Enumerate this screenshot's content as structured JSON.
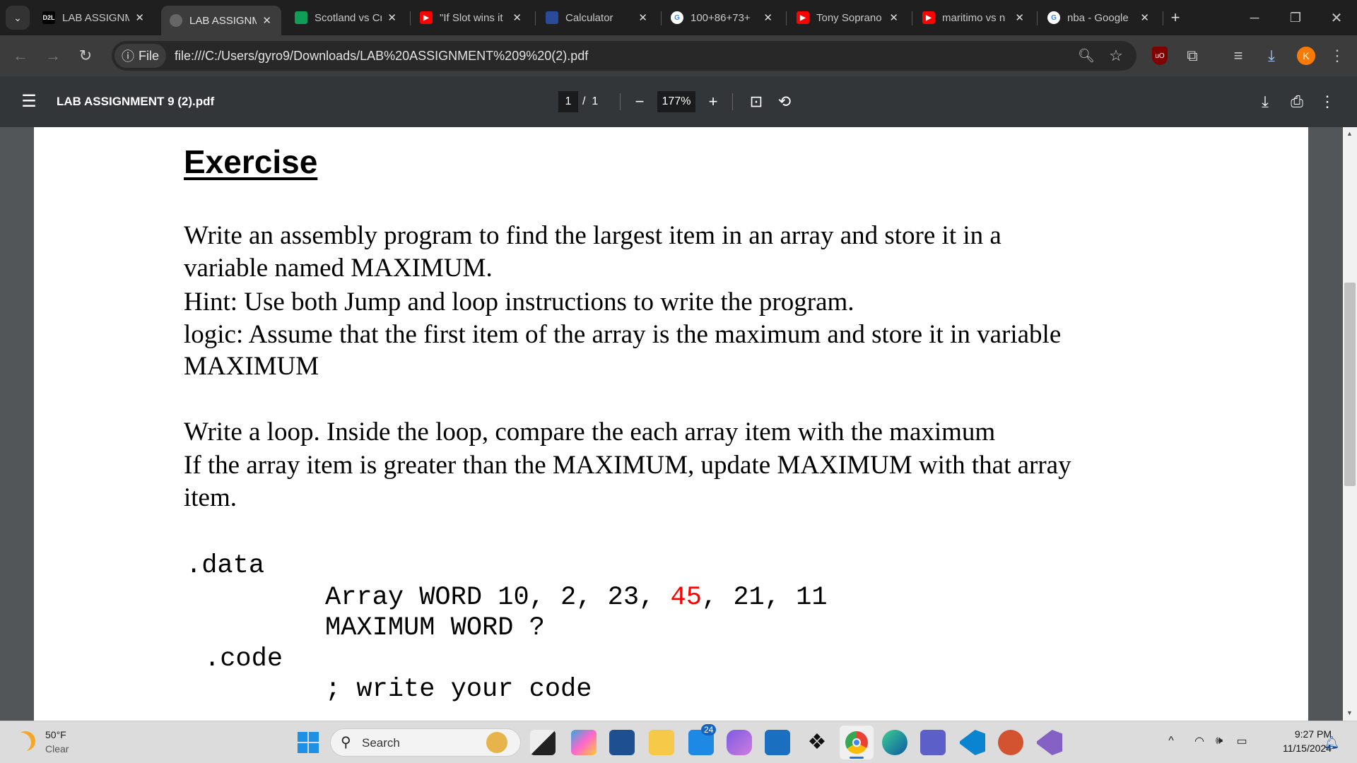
{
  "tabs": [
    {
      "title": "LAB ASSIGNMENT",
      "favicon": "d2l-icon",
      "fav_text": "D2L",
      "active": false
    },
    {
      "title": "LAB ASSIGNMENT",
      "favicon": "globe-icon",
      "active": true
    },
    {
      "title": "Scotland vs Croatia",
      "favicon": "sheets-icon"
    },
    {
      "title": "\"If Slot wins it",
      "favicon": "youtube-icon"
    },
    {
      "title": "Calculator",
      "favicon": "calculator-icon"
    },
    {
      "title": "100+86+73+",
      "favicon": "google-icon"
    },
    {
      "title": "Tony Soprano",
      "favicon": "youtube-icon"
    },
    {
      "title": "maritimo vs n",
      "favicon": "youtube-icon"
    },
    {
      "title": "nba - Google",
      "favicon": "google-icon"
    }
  ],
  "address": {
    "scheme_chip": "File",
    "url": "file:///C:/Users/gyro9/Downloads/LAB%20ASSIGNMENT%209%20(2).pdf"
  },
  "profile_initial": "K",
  "pdf": {
    "filename": "LAB ASSIGNMENT 9 (2).pdf",
    "page_current": "1",
    "page_total": "/  1",
    "zoom": "177%"
  },
  "document": {
    "heading": "Exercise",
    "para1": [
      "Write an assembly program to find the largest item in an array and store it in a",
      "variable named MAXIMUM.",
      "Hint: Use both Jump and loop instructions to write the program.",
      "logic: Assume that the first item of the array is the maximum and store it in variable",
      "MAXIMUM"
    ],
    "para2": [
      "Write a loop. Inside the loop, compare the each array item with the maximum",
      "If the array item is greater than the MAXIMUM, update MAXIMUM with that array",
      "item."
    ],
    "code": {
      "data_directive": ".data",
      "array_prefix": "Array WORD 10, 2, 23, ",
      "array_highlight": "45",
      "array_suffix": ", 21, 11",
      "max_line": "MAXIMUM WORD ?",
      "code_directive": ".code",
      "comment": "; write your code"
    },
    "highlight_color": "#ff0000"
  },
  "taskbar": {
    "weather_temp": "50°F",
    "weather_desc": "Clear",
    "search_placeholder": "Search",
    "mail_badge": "24",
    "time": "9:27 PM",
    "date": "11/15/2024"
  }
}
